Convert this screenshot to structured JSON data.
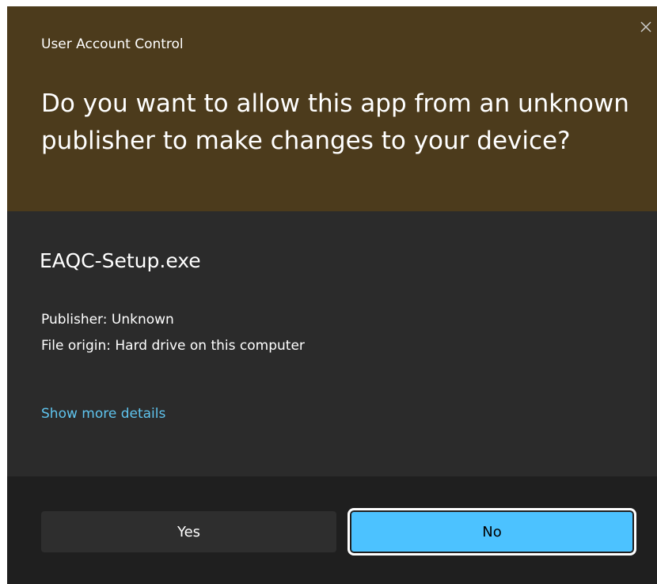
{
  "dialog": {
    "window_title": "User Account Control",
    "question": "Do you want to allow this app from an unknown publisher to make changes to your device?",
    "app_name": "EAQC-Setup.exe",
    "publisher": "Publisher: Unknown",
    "file_origin": "File origin: Hard drive on this computer",
    "details_link": "Show more details",
    "buttons": {
      "yes": "Yes",
      "no": "No"
    },
    "icons": {
      "close": "close-icon"
    },
    "colors": {
      "header_bg": "#4c3b1c",
      "body_bg": "#2b2b2b",
      "footer_bg": "#1f1f1f",
      "link": "#5fc4ee",
      "primary_button": "#4cc2ff"
    }
  }
}
